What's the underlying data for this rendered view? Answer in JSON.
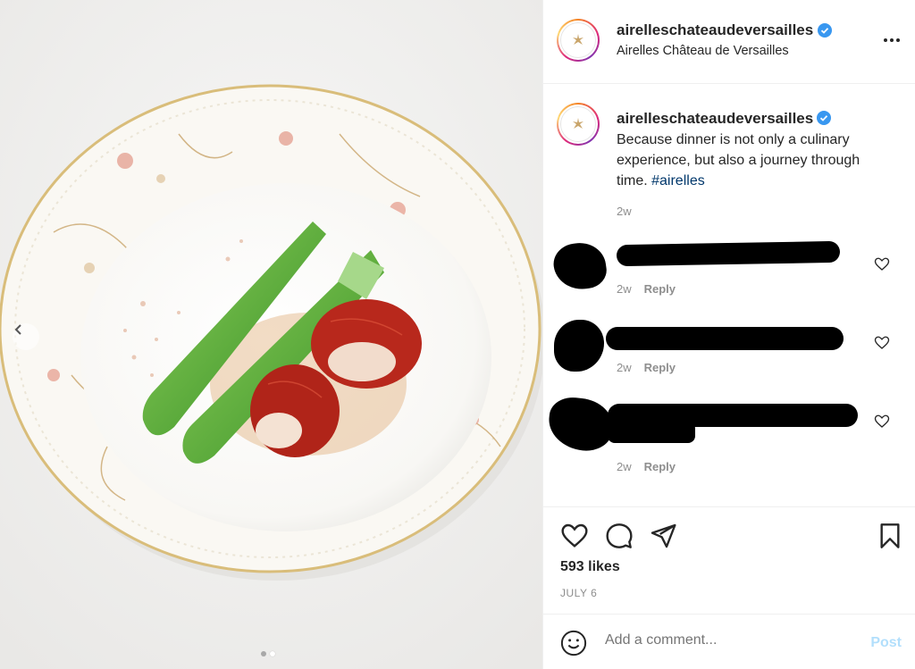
{
  "header": {
    "username": "airelleschateaudeversailles",
    "subtitle": "Airelles Château de Versailles",
    "more_icon": "more-horizontal-icon"
  },
  "caption": {
    "username": "airelleschateaudeversailles",
    "text": "Because dinner is not only a culinary experience, but also a journey through time.",
    "hashtag": "#airelles",
    "time": "2w"
  },
  "comments": [
    {
      "time": "2w",
      "reply_label": "Reply"
    },
    {
      "time": "2w",
      "reply_label": "Reply"
    },
    {
      "time": "2w",
      "reply_label": "Reply"
    }
  ],
  "actions": {
    "likes": "593 likes",
    "date": "JULY 6"
  },
  "add_comment": {
    "placeholder": "Add a comment...",
    "post_label": "Post"
  },
  "carousel": {
    "slides": 2,
    "current": 2
  },
  "colors": {
    "verified": "#3897f0",
    "hashtag": "#00376b",
    "post_disabled": "#b2dffc",
    "muted": "#8e8e8e"
  }
}
